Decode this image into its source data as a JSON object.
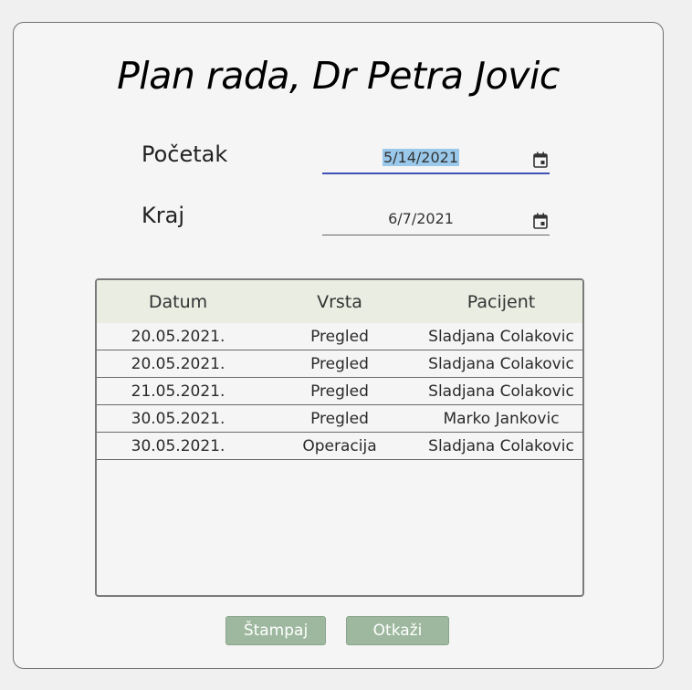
{
  "dialog": {
    "title": "Plan rada, Dr Petra Jovic"
  },
  "form": {
    "start_label": "Početak",
    "start_value": "5/14/2021",
    "end_label": "Kraj",
    "end_value": "6/7/2021"
  },
  "table": {
    "columns": [
      "Datum",
      "Vrsta",
      "Pacijent"
    ],
    "rows": [
      [
        "20.05.2021.",
        "Pregled",
        "Sladjana Colakovic"
      ],
      [
        "20.05.2021.",
        "Pregled",
        "Sladjana Colakovic"
      ],
      [
        "21.05.2021.",
        "Pregled",
        "Sladjana Colakovic"
      ],
      [
        "30.05.2021.",
        "Pregled",
        "Marko Jankovic"
      ],
      [
        "30.05.2021.",
        "Operacija",
        "Sladjana Colakovic"
      ]
    ]
  },
  "buttons": {
    "print_label": "Štampaj",
    "cancel_label": "Otkaži"
  },
  "colors": {
    "header_bg": "#e9ede2",
    "button_bg": "#9db89f",
    "focus_underline": "#3f51b5",
    "selection": "#99c8ea"
  },
  "icons": {
    "date_picker": "calendar-icon"
  }
}
